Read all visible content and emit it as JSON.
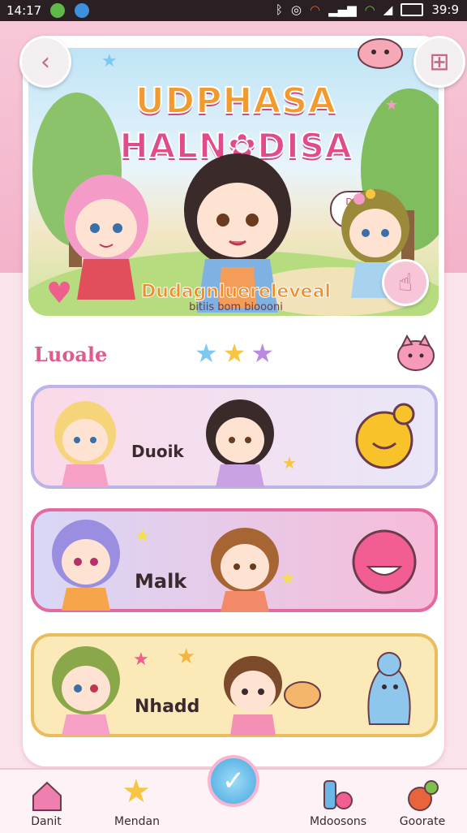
{
  "status_bar": {
    "time": "14:17",
    "right_text": "39:9",
    "icons": [
      "bluetooth-icon",
      "nfc-icon",
      "wifi-icon",
      "signal-icon",
      "battery-icon"
    ]
  },
  "header": {
    "back_icon": "back-arrow-icon",
    "menu_icon": "grid-menu-icon"
  },
  "banner": {
    "title_line1": "UDPHASA",
    "title_line2": "HALN✿DISA",
    "speech_text": "Dunsa! Docac!",
    "subtitle": "Dudagnluereleveal",
    "subtitle_small": "bitiis bom bioooni",
    "action_icon": "cursor-icon"
  },
  "section": {
    "title": "Luoale",
    "stars": [
      "#7cc8f0",
      "#f6c542",
      "#b98ae0"
    ]
  },
  "rows": [
    {
      "label": "Duoik",
      "icon": "smiley-blob-icon"
    },
    {
      "label": "Malk",
      "icon": "pink-ball-icon"
    },
    {
      "label": "Nhadd",
      "icon": "blue-ghost-icon"
    }
  ],
  "bottom_nav": {
    "items": [
      {
        "label": "Danit",
        "icon": "home-icon"
      },
      {
        "label": "Mendan",
        "icon": "star-icon"
      },
      {
        "label": "",
        "icon": "check-icon"
      },
      {
        "label": "Mdoosons",
        "icon": "blocks-icon"
      },
      {
        "label": "Goorate",
        "icon": "fruit-icon"
      }
    ]
  },
  "colors": {
    "accent_pink": "#e05a90",
    "accent_orange": "#ef8d26",
    "accent_blue": "#45a8df"
  }
}
